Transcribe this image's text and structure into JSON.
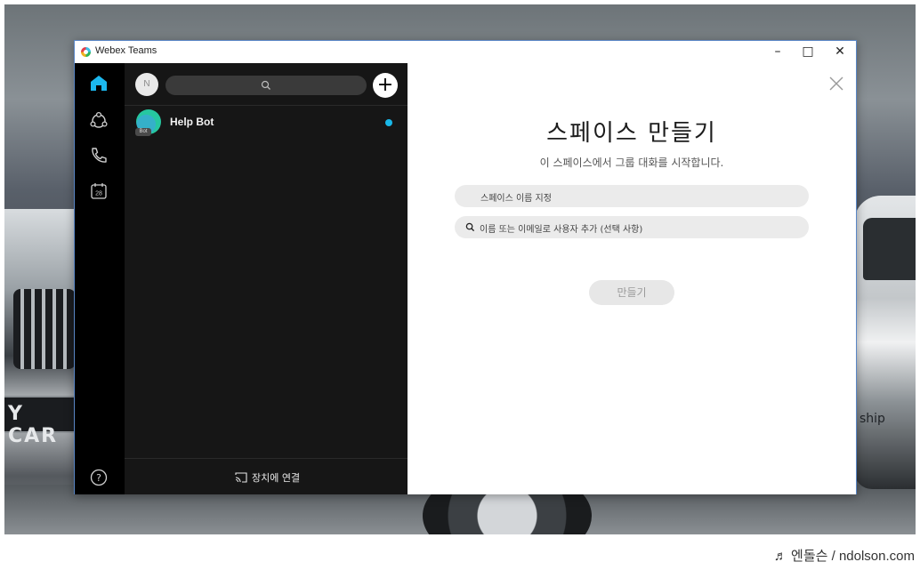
{
  "window": {
    "title": "Webex Teams",
    "controls": {
      "minimize": "–",
      "maximize": "□",
      "close": "✕"
    }
  },
  "rail": {
    "items": [
      "home-icon",
      "teams-icon",
      "calls-icon",
      "calendar-icon"
    ],
    "calendar_day": "28",
    "help_icon": "help-icon",
    "accent": "#1cb8ef"
  },
  "list": {
    "avatar_initial": "N",
    "spaces": [
      {
        "name": "Help Bot",
        "tag": "Bot",
        "unread": true
      }
    ],
    "connect_label": "장치에 연결"
  },
  "create": {
    "title": "스페이스 만들기",
    "subtitle": "이 스페이스에서 그룹 대화를 시작합니다.",
    "name_placeholder": "스페이스 이름 지정",
    "people_placeholder": "이름 또는 이메일로 사용자 추가 (선택 사항)",
    "button_label": "만들기"
  },
  "wallpaper": {
    "plate_text": "Y CAR",
    "side_text": "ship"
  },
  "credit": "♬ 엔돌슨 / ndolson.com"
}
